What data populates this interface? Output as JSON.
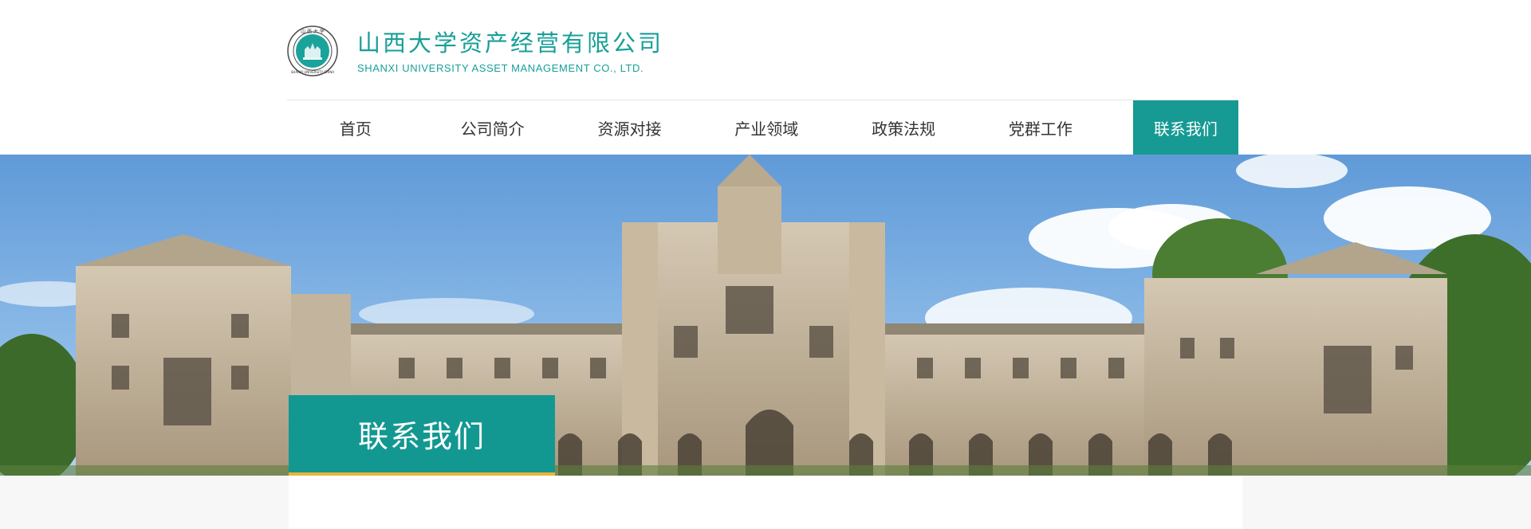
{
  "brand": {
    "name_cn": "山西大学资产经营有限公司",
    "name_en": "SHANXI UNIVERSITY ASSET MANAGEMENT CO., LTD.",
    "emblem_icon": "university-seal-icon",
    "emblem_top_text": "山 西 大 学",
    "emblem_ring_text": "SHANXI UNIVERSITY CHINA"
  },
  "nav": {
    "items": [
      {
        "label": "首页"
      },
      {
        "label": "公司简介"
      },
      {
        "label": "资源对接"
      },
      {
        "label": "产业领域"
      },
      {
        "label": "政策法规"
      },
      {
        "label": "党群工作"
      },
      {
        "label": "联系我们",
        "active": true
      }
    ]
  },
  "banner": {
    "image": "gothic-college-building-photo",
    "title": "联系我们"
  },
  "colors": {
    "accent": "#169a93",
    "title_underline": "#e9b53a",
    "nav_text": "#333333",
    "page_bg": "#f7f7f7"
  }
}
